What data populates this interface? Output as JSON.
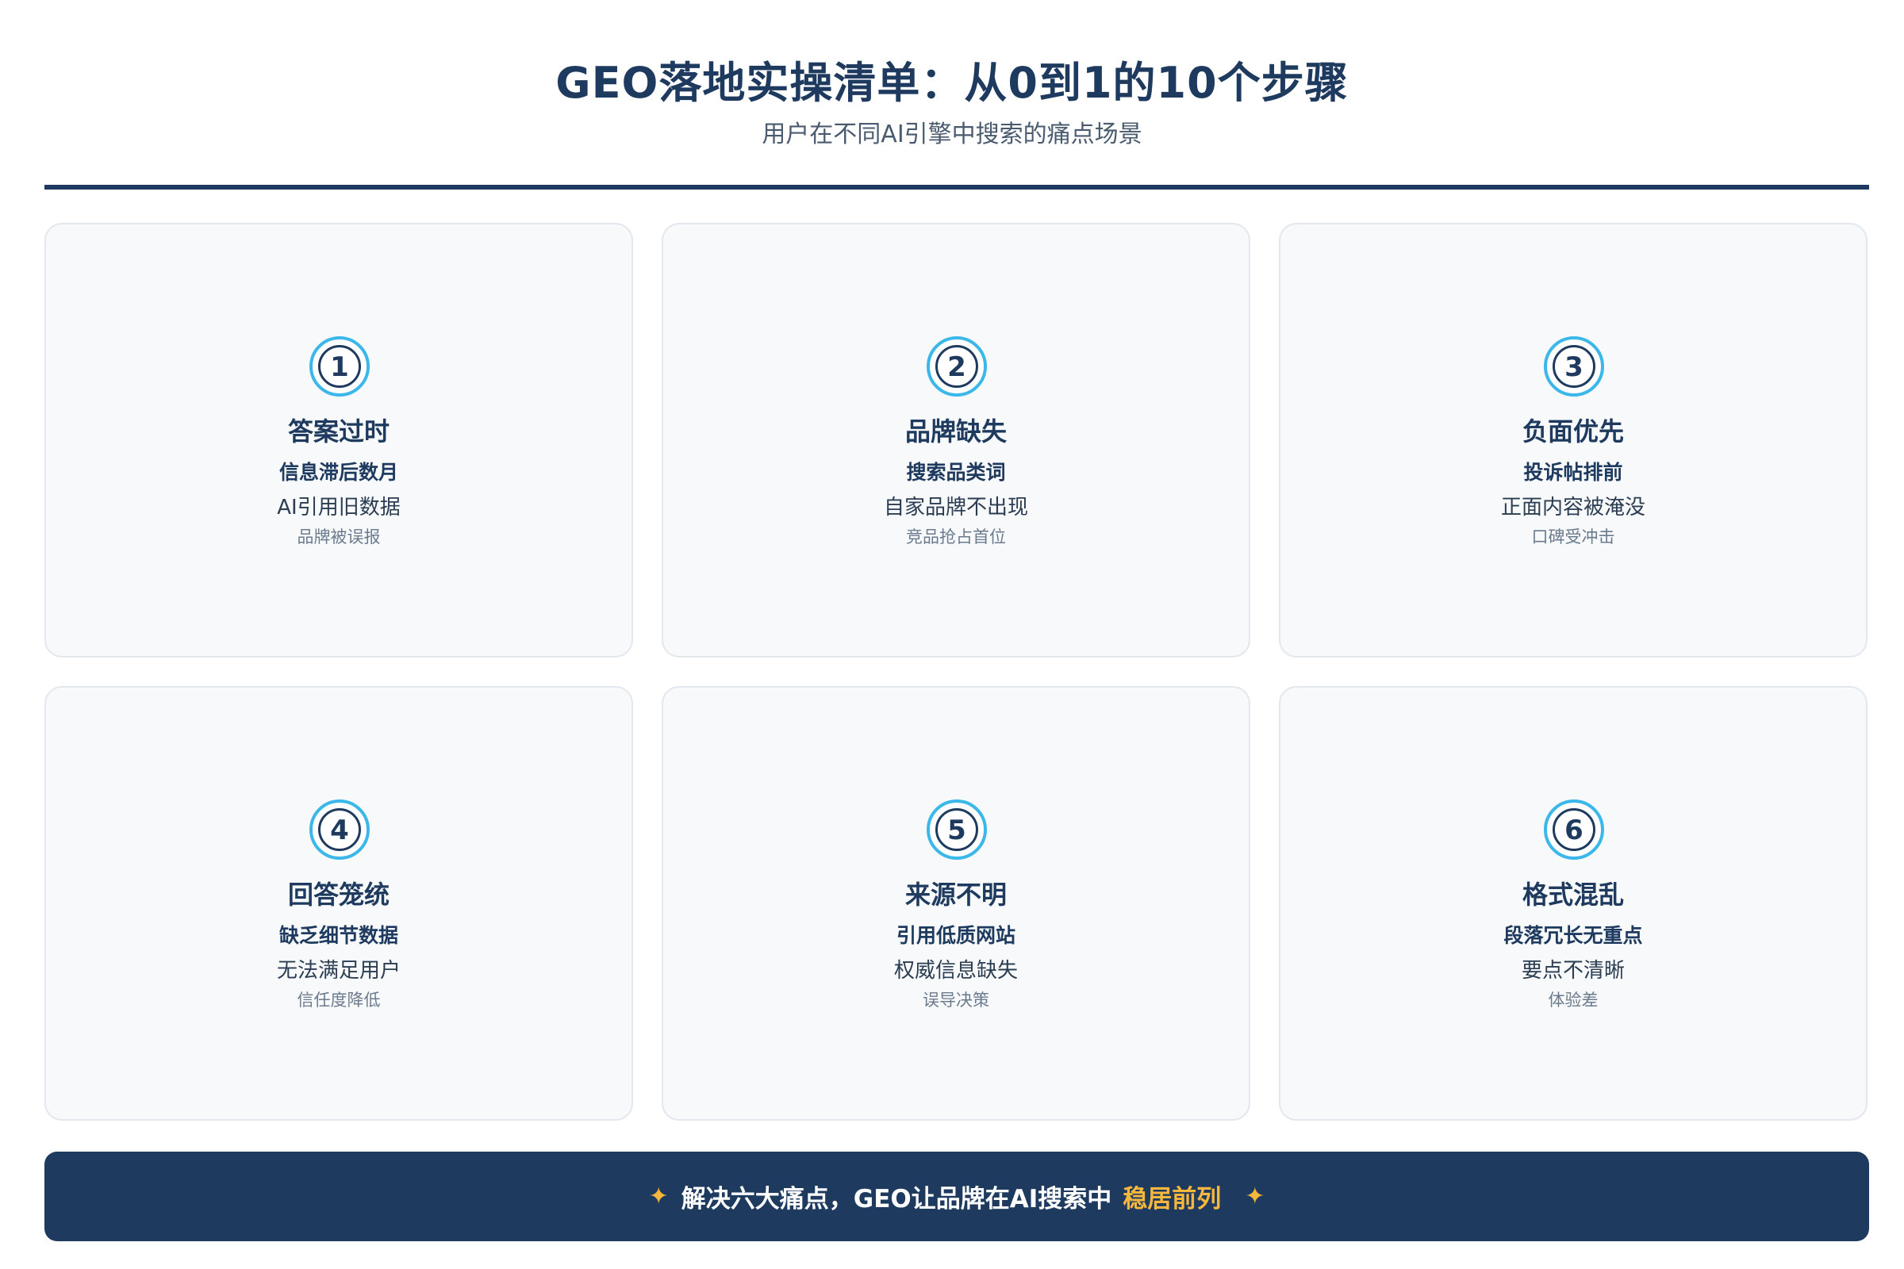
{
  "header": {
    "title": "GEO落地实操清单：从0到1的10个步骤",
    "subtitle": "用户在不同AI引擎中搜索的痛点场景"
  },
  "cards": [
    {
      "number": "1",
      "title": "答案过时",
      "subtitle": "信息滞后数月",
      "line": "AI引用旧数据",
      "note": "品牌被误报"
    },
    {
      "number": "2",
      "title": "品牌缺失",
      "subtitle": "搜索品类词",
      "line": "自家品牌不出现",
      "note": "竞品抢占首位"
    },
    {
      "number": "3",
      "title": "负面优先",
      "subtitle": "投诉帖排前",
      "line": "正面内容被淹没",
      "note": "口碑受冲击"
    },
    {
      "number": "4",
      "title": "回答笼统",
      "subtitle": "缺乏细节数据",
      "line": "无法满足用户",
      "note": "信任度降低"
    },
    {
      "number": "5",
      "title": "来源不明",
      "subtitle": "引用低质网站",
      "line": "权威信息缺失",
      "note": "误导决策"
    },
    {
      "number": "6",
      "title": "格式混乱",
      "subtitle": "段落冗长无重点",
      "line": "要点不清晰",
      "note": "体验差"
    }
  ],
  "banner": {
    "star": "✦",
    "text": "解决六大痛点，GEO让品牌在AI搜索中",
    "highlight": "稳居前列"
  },
  "colors": {
    "primary": "#1e3a5f",
    "accent_ring": "#3bb7ea",
    "highlight": "#f6b73c",
    "card_bg": "#f7f9fb"
  }
}
